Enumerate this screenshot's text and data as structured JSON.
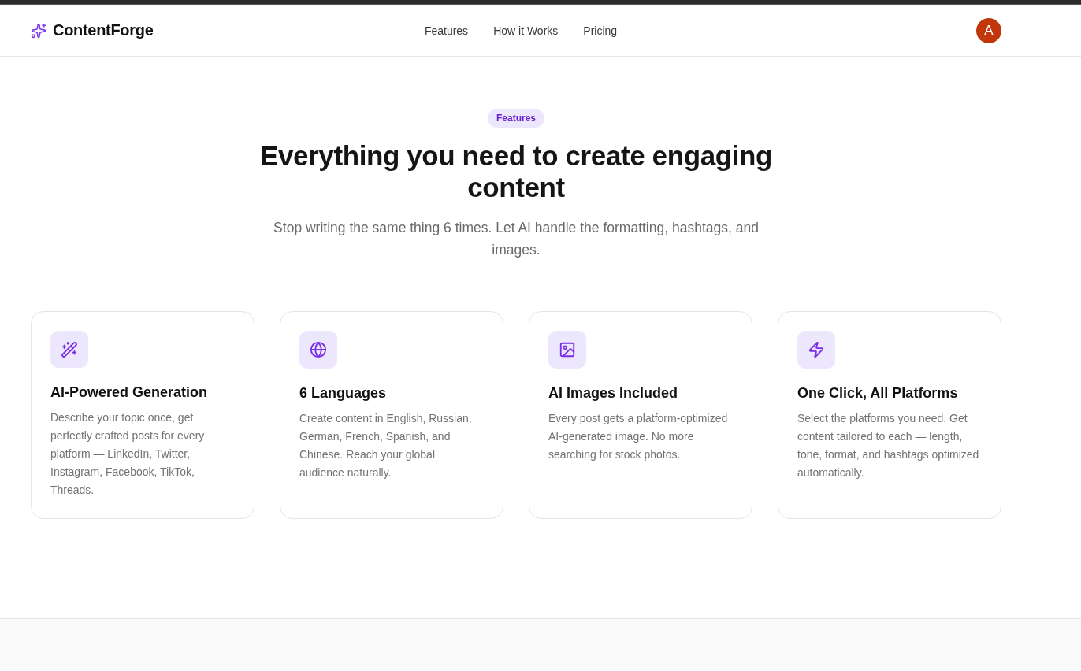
{
  "header": {
    "logo": {
      "text": "ContentForge"
    },
    "nav": [
      {
        "label": "Features"
      },
      {
        "label": "How it Works"
      },
      {
        "label": "Pricing"
      }
    ],
    "avatar": {
      "initial": "A"
    }
  },
  "features_section": {
    "badge": "Features",
    "title": "Everything you need to create engaging content",
    "subtitle": "Stop writing the same thing 6 times. Let AI handle the formatting, hashtags, and images.",
    "cards": [
      {
        "kind": "wand",
        "title": "AI-Powered Generation",
        "description": "Describe your topic once, get perfectly crafted posts for every platform — LinkedIn, Twitter, Instagram, Facebook, TikTok, Threads."
      },
      {
        "kind": "globe",
        "title": "6 Languages",
        "description": "Create content in English, Russian, German, French, Spanish, and Chinese. Reach your global audience naturally."
      },
      {
        "kind": "image",
        "title": "AI Images Included",
        "description": "Every post gets a platform-optimized AI-generated image. No more searching for stock photos."
      },
      {
        "kind": "bolt",
        "title": "One Click, All Platforms",
        "description": "Select the platforms you need. Get content tailored to each — length, tone, format, and hashtags optimized automatically."
      }
    ]
  }
}
